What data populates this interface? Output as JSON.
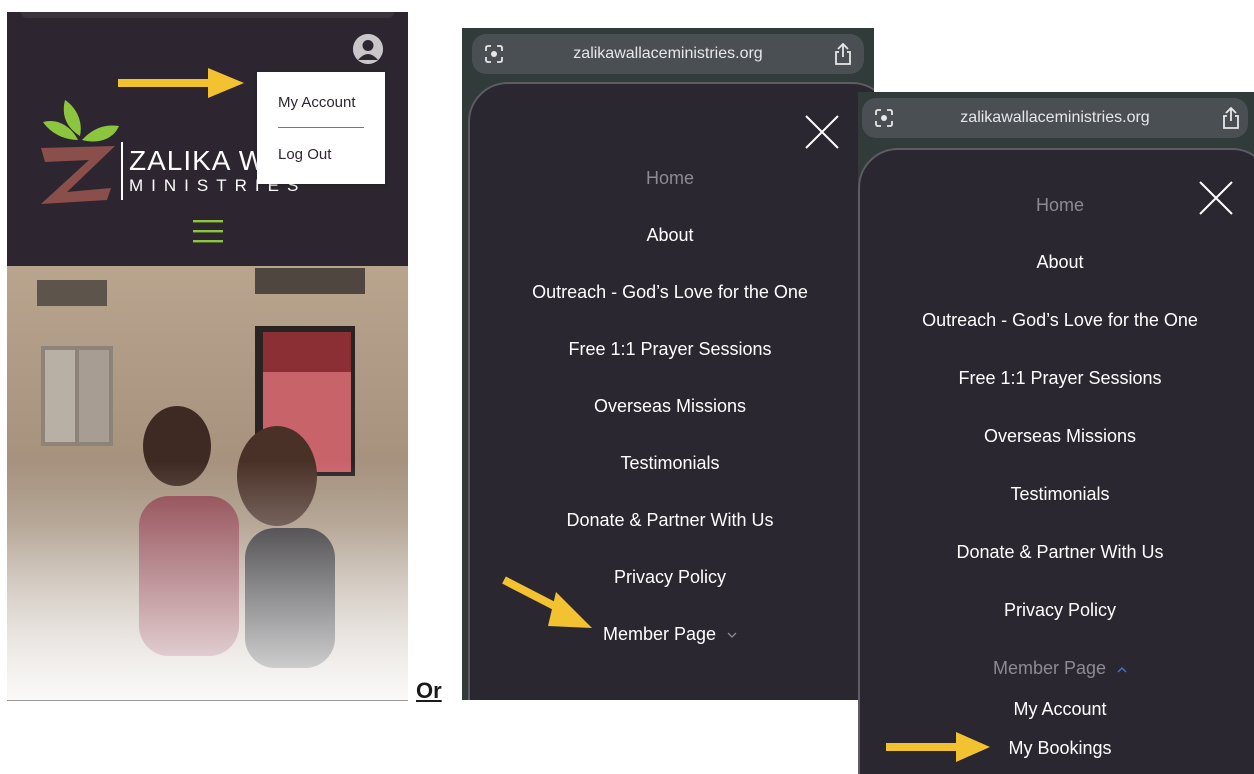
{
  "panel1": {
    "logo": {
      "line1": "ZALIKA W",
      "line2": "MINISTRIES"
    },
    "dropdown": {
      "my_account": "My Account",
      "log_out": "Log Out"
    }
  },
  "or_label": "Or",
  "panel2": {
    "url": "zalikawallaceministries.org",
    "menu": [
      "Home",
      "About",
      "Outreach - God’s Love for the One",
      "Free 1:1 Prayer Sessions",
      "Overseas Missions",
      "Testimonials",
      "Donate & Partner With Us",
      "Privacy Policy",
      "Member Page"
    ]
  },
  "panel3": {
    "url": "zalikawallaceministries.org",
    "menu": [
      "Home",
      "About",
      "Outreach - God’s Love for the One",
      "Free 1:1 Prayer Sessions",
      "Overseas Missions",
      "Testimonials",
      "Donate & Partner With Us",
      "Privacy Policy",
      "Member Page"
    ],
    "submenu": [
      "My Account",
      "My Bookings"
    ]
  },
  "colors": {
    "site_bg": "#2d2631",
    "accent_green": "#8cc63f",
    "logo_maroon": "#8a4f4b",
    "arrow_yellow": "#f2c230"
  }
}
